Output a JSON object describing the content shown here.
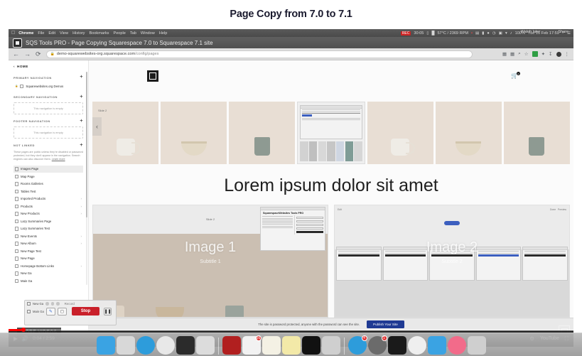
{
  "slide": {
    "title": "Page Copy from 7.0 to 7.1"
  },
  "macbar": {
    "apple_icon": "apple-icon",
    "items": [
      "Chrome",
      "File",
      "Edit",
      "View",
      "History",
      "Bookmarks",
      "People",
      "Tab",
      "Window",
      "Help"
    ],
    "status": {
      "recording_chip": "REC",
      "recording_time": "30:05",
      "display_icon": "display-icon",
      "signal_icon": "signal-icon",
      "temperature": "57°C / 2369 RPM",
      "dot": "•",
      "printer_icon": "printer-icon",
      "battery_icon": "battery-icon",
      "bluetooth_icon": "bluetooth-icon",
      "clock_icon": "clock-icon",
      "flag_icon": "flag-icon",
      "wifi_icon": "wifi-icon",
      "volume_icon": "volume-icon",
      "battery_percent": "100%",
      "battery_chip": "BAT",
      "datetime": "Tue 16 Feb 17:59",
      "search_icon": "search-icon",
      "menu_icon": "control-center-icon"
    }
  },
  "window": {
    "app_icon": "sqs-tools-app-icon",
    "title": "SQS Tools PRO - Page Copying Squarespace 7.0 to Squarespace 7.1 site"
  },
  "chrome": {
    "back_icon": "back-arrow-icon",
    "forward_icon": "forward-arrow-icon",
    "reload_icon": "reload-icon",
    "lock_icon": "lock-icon",
    "url_host": "demo-squarewebsites-org.squarespace.com",
    "url_path": "/config/pages",
    "toolbar_icons": [
      "media-cast-icon",
      "qr-code-icon",
      "search-icon",
      "bookmark-star-icon",
      "extension-green-icon",
      "extensions-puzzle-icon",
      "downloads-icon",
      "profile-avatar-icon",
      "more-menu-icon"
    ]
  },
  "sidebar": {
    "home_chevron_icon": "chevron-left-icon",
    "home_label": "HOME",
    "sections": [
      {
        "title": "PRIMARY NAVIGATION",
        "add_icon": "plus-icon",
        "items": [
          {
            "label": "Squarewebsites.org Demos",
            "icon": "page-icon",
            "selected": false
          }
        ],
        "empty_text": ""
      },
      {
        "title": "SECONDARY NAVIGATION",
        "add_icon": "plus-icon",
        "items": [],
        "empty_text": "This navigation is empty"
      },
      {
        "title": "FOOTER NAVIGATION",
        "add_icon": "plus-icon",
        "items": [],
        "empty_text": "This navigation is empty"
      }
    ],
    "not_linked": {
      "title": "NOT LINKED",
      "add_icon": "plus-icon",
      "description": "These pages are public unless they're disabled or password protected, but they don't appear in the navigation. Search engines can also discover them.",
      "learn_more": "Learn more",
      "items": [
        {
          "label": "Images Page",
          "icon": "page-icon",
          "selected": true,
          "chevron": false
        },
        {
          "label": "Map Page",
          "icon": "page-icon",
          "selected": false,
          "chevron": false
        },
        {
          "label": "Rooms Galleries",
          "icon": "page-icon",
          "selected": false,
          "chevron": false
        },
        {
          "label": "Tables Test",
          "icon": "page-icon",
          "selected": false,
          "chevron": false
        },
        {
          "label": "Imported Products",
          "icon": "commerce-icon",
          "selected": false,
          "chevron": true
        },
        {
          "label": "Products",
          "icon": "folder-icon",
          "selected": false,
          "chevron": true
        },
        {
          "label": "New Products",
          "icon": "commerce-icon",
          "selected": false,
          "chevron": true
        },
        {
          "label": "Lazy Summaries Page",
          "icon": "page-icon",
          "selected": false,
          "chevron": false
        },
        {
          "label": "Lazy Summaries Test",
          "icon": "page-icon",
          "selected": false,
          "chevron": false
        },
        {
          "label": "New Events",
          "icon": "events-icon",
          "selected": false,
          "chevron": true
        },
        {
          "label": "New Album",
          "icon": "album-icon",
          "selected": false,
          "chevron": true
        },
        {
          "label": "New Page Test",
          "icon": "page-icon",
          "selected": false,
          "chevron": false
        },
        {
          "label": "New Page",
          "icon": "page-icon",
          "selected": false,
          "chevron": false
        },
        {
          "label": "Homepage Bottom Links",
          "icon": "index-icon",
          "selected": false,
          "chevron": true
        },
        {
          "label": "New Ga",
          "icon": "page-icon",
          "selected": false,
          "chevron": false
        },
        {
          "label": "Main Ga",
          "icon": "page-icon",
          "selected": false,
          "chevron": false
        }
      ]
    }
  },
  "preview": {
    "logo_icon": "squarespace-site-logo",
    "cart_icon": "shopping-cart-icon",
    "cart_badge": "0",
    "gallery": {
      "prev_icon": "chevron-left-icon",
      "slide_label": "Slide 2",
      "items": [
        "mug-image",
        "bowl-image",
        "cup-image",
        "screenshot-image",
        "mug-image-2",
        "bowl-image-2",
        "cup-image-2"
      ]
    },
    "hero_title": "Lorem ipsum dolor sit amet",
    "blocks": [
      {
        "caption": "Image 1",
        "subtitle": "Subtitle 1",
        "label": "Slide 2"
      },
      {
        "caption": "Image 2",
        "subtitle": "Subtitle 2",
        "label": ""
      }
    ],
    "footer": {
      "notice": "The site is password protected, anyone with the password can see the site.",
      "publish_label": "Publish Your Site"
    }
  },
  "recorder": {
    "record_label": "Record",
    "stop_label": "Stop",
    "pause_icon": "pause-icon",
    "pen_icon": "pen-icon",
    "frame_icon": "frame-icon",
    "rows": [
      "New Ga",
      "Main Ga"
    ]
  },
  "youtube": {
    "more_videos_label": "MORE VIDEOS",
    "watch_later_label": "Watch later",
    "share_label": "Share",
    "play_icon": "play-icon",
    "volume_icon": "volume-icon",
    "time": "0:04 / 2:59",
    "settings_icon": "gear-icon",
    "logo": "YouTube",
    "fullscreen_icon": "fullscreen-icon",
    "progress_percent": 2.3,
    "accent_color": "#ff0000"
  },
  "dock": {
    "items": [
      {
        "name": "finder",
        "color": "#3aa3e3",
        "icon": "finder-icon",
        "badge": ""
      },
      {
        "name": "launchpad",
        "color": "#d8d8d8",
        "icon": "launchpad-icon",
        "badge": ""
      },
      {
        "name": "safari",
        "color": "#2d9cdb",
        "icon": "safari-icon",
        "badge": ""
      },
      {
        "name": "chrome",
        "color": "#e8e8e8",
        "icon": "chrome-icon",
        "badge": ""
      },
      {
        "name": "sublime-text",
        "color": "#2b2b2b",
        "icon": "sublime-icon",
        "badge": ""
      },
      {
        "name": "preview",
        "color": "#dcdcdc",
        "icon": "preview-icon",
        "badge": ""
      },
      {
        "name": "filezilla",
        "color": "#b11f1f",
        "icon": "filezilla-icon",
        "badge": ""
      },
      {
        "name": "calendar",
        "color": "#f2f2f2",
        "icon": "calendar-icon",
        "badge": "16"
      },
      {
        "name": "notes",
        "color": "#f4f1e4",
        "icon": "notes-icon",
        "badge": ""
      },
      {
        "name": "stickies",
        "color": "#f3e9a8",
        "icon": "stickies-icon",
        "badge": ""
      },
      {
        "name": "terminal",
        "color": "#111111",
        "icon": "terminal-icon",
        "badge": ""
      },
      {
        "name": "activity-monitor",
        "color": "#cfcfcf",
        "icon": "activity-icon",
        "badge": ""
      },
      {
        "name": "app-store",
        "color": "#2d9cdb",
        "icon": "appstore-icon",
        "badge": "4"
      },
      {
        "name": "system-preferences",
        "color": "#6b6b6b",
        "icon": "gear-icon",
        "badge": "1"
      },
      {
        "name": "keynote",
        "color": "#1a1a1a",
        "icon": "keynote-icon",
        "badge": ""
      },
      {
        "name": "photos",
        "color": "#efefef",
        "icon": "photos-icon",
        "badge": ""
      },
      {
        "name": "mail",
        "color": "#3aa3e3",
        "icon": "mail-icon",
        "badge": ""
      },
      {
        "name": "music",
        "color": "#f26b8a",
        "icon": "music-icon",
        "badge": ""
      },
      {
        "name": "trash",
        "color": "#cfcfcf",
        "icon": "trash-icon",
        "badge": ""
      }
    ]
  }
}
